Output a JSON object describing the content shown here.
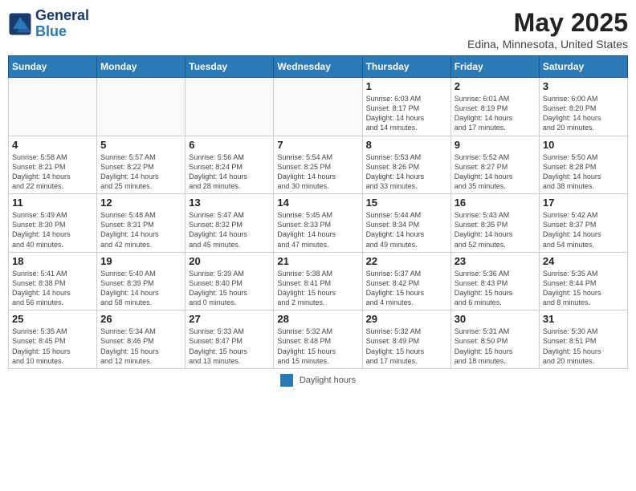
{
  "header": {
    "logo_line1": "General",
    "logo_line2": "Blue",
    "month_year": "May 2025",
    "location": "Edina, Minnesota, United States"
  },
  "days_of_week": [
    "Sunday",
    "Monday",
    "Tuesday",
    "Wednesday",
    "Thursday",
    "Friday",
    "Saturday"
  ],
  "footer": {
    "label": "Daylight hours"
  },
  "weeks": [
    [
      {
        "day": "",
        "info": ""
      },
      {
        "day": "",
        "info": ""
      },
      {
        "day": "",
        "info": ""
      },
      {
        "day": "",
        "info": ""
      },
      {
        "day": "1",
        "info": "Sunrise: 6:03 AM\nSunset: 8:17 PM\nDaylight: 14 hours\nand 14 minutes."
      },
      {
        "day": "2",
        "info": "Sunrise: 6:01 AM\nSunset: 8:19 PM\nDaylight: 14 hours\nand 17 minutes."
      },
      {
        "day": "3",
        "info": "Sunrise: 6:00 AM\nSunset: 8:20 PM\nDaylight: 14 hours\nand 20 minutes."
      }
    ],
    [
      {
        "day": "4",
        "info": "Sunrise: 5:58 AM\nSunset: 8:21 PM\nDaylight: 14 hours\nand 22 minutes."
      },
      {
        "day": "5",
        "info": "Sunrise: 5:57 AM\nSunset: 8:22 PM\nDaylight: 14 hours\nand 25 minutes."
      },
      {
        "day": "6",
        "info": "Sunrise: 5:56 AM\nSunset: 8:24 PM\nDaylight: 14 hours\nand 28 minutes."
      },
      {
        "day": "7",
        "info": "Sunrise: 5:54 AM\nSunset: 8:25 PM\nDaylight: 14 hours\nand 30 minutes."
      },
      {
        "day": "8",
        "info": "Sunrise: 5:53 AM\nSunset: 8:26 PM\nDaylight: 14 hours\nand 33 minutes."
      },
      {
        "day": "9",
        "info": "Sunrise: 5:52 AM\nSunset: 8:27 PM\nDaylight: 14 hours\nand 35 minutes."
      },
      {
        "day": "10",
        "info": "Sunrise: 5:50 AM\nSunset: 8:28 PM\nDaylight: 14 hours\nand 38 minutes."
      }
    ],
    [
      {
        "day": "11",
        "info": "Sunrise: 5:49 AM\nSunset: 8:30 PM\nDaylight: 14 hours\nand 40 minutes."
      },
      {
        "day": "12",
        "info": "Sunrise: 5:48 AM\nSunset: 8:31 PM\nDaylight: 14 hours\nand 42 minutes."
      },
      {
        "day": "13",
        "info": "Sunrise: 5:47 AM\nSunset: 8:32 PM\nDaylight: 14 hours\nand 45 minutes."
      },
      {
        "day": "14",
        "info": "Sunrise: 5:45 AM\nSunset: 8:33 PM\nDaylight: 14 hours\nand 47 minutes."
      },
      {
        "day": "15",
        "info": "Sunrise: 5:44 AM\nSunset: 8:34 PM\nDaylight: 14 hours\nand 49 minutes."
      },
      {
        "day": "16",
        "info": "Sunrise: 5:43 AM\nSunset: 8:35 PM\nDaylight: 14 hours\nand 52 minutes."
      },
      {
        "day": "17",
        "info": "Sunrise: 5:42 AM\nSunset: 8:37 PM\nDaylight: 14 hours\nand 54 minutes."
      }
    ],
    [
      {
        "day": "18",
        "info": "Sunrise: 5:41 AM\nSunset: 8:38 PM\nDaylight: 14 hours\nand 56 minutes."
      },
      {
        "day": "19",
        "info": "Sunrise: 5:40 AM\nSunset: 8:39 PM\nDaylight: 14 hours\nand 58 minutes."
      },
      {
        "day": "20",
        "info": "Sunrise: 5:39 AM\nSunset: 8:40 PM\nDaylight: 15 hours\nand 0 minutes."
      },
      {
        "day": "21",
        "info": "Sunrise: 5:38 AM\nSunset: 8:41 PM\nDaylight: 15 hours\nand 2 minutes."
      },
      {
        "day": "22",
        "info": "Sunrise: 5:37 AM\nSunset: 8:42 PM\nDaylight: 15 hours\nand 4 minutes."
      },
      {
        "day": "23",
        "info": "Sunrise: 5:36 AM\nSunset: 8:43 PM\nDaylight: 15 hours\nand 6 minutes."
      },
      {
        "day": "24",
        "info": "Sunrise: 5:35 AM\nSunset: 8:44 PM\nDaylight: 15 hours\nand 8 minutes."
      }
    ],
    [
      {
        "day": "25",
        "info": "Sunrise: 5:35 AM\nSunset: 8:45 PM\nDaylight: 15 hours\nand 10 minutes."
      },
      {
        "day": "26",
        "info": "Sunrise: 5:34 AM\nSunset: 8:46 PM\nDaylight: 15 hours\nand 12 minutes."
      },
      {
        "day": "27",
        "info": "Sunrise: 5:33 AM\nSunset: 8:47 PM\nDaylight: 15 hours\nand 13 minutes."
      },
      {
        "day": "28",
        "info": "Sunrise: 5:32 AM\nSunset: 8:48 PM\nDaylight: 15 hours\nand 15 minutes."
      },
      {
        "day": "29",
        "info": "Sunrise: 5:32 AM\nSunset: 8:49 PM\nDaylight: 15 hours\nand 17 minutes."
      },
      {
        "day": "30",
        "info": "Sunrise: 5:31 AM\nSunset: 8:50 PM\nDaylight: 15 hours\nand 18 minutes."
      },
      {
        "day": "31",
        "info": "Sunrise: 5:30 AM\nSunset: 8:51 PM\nDaylight: 15 hours\nand 20 minutes."
      }
    ]
  ]
}
